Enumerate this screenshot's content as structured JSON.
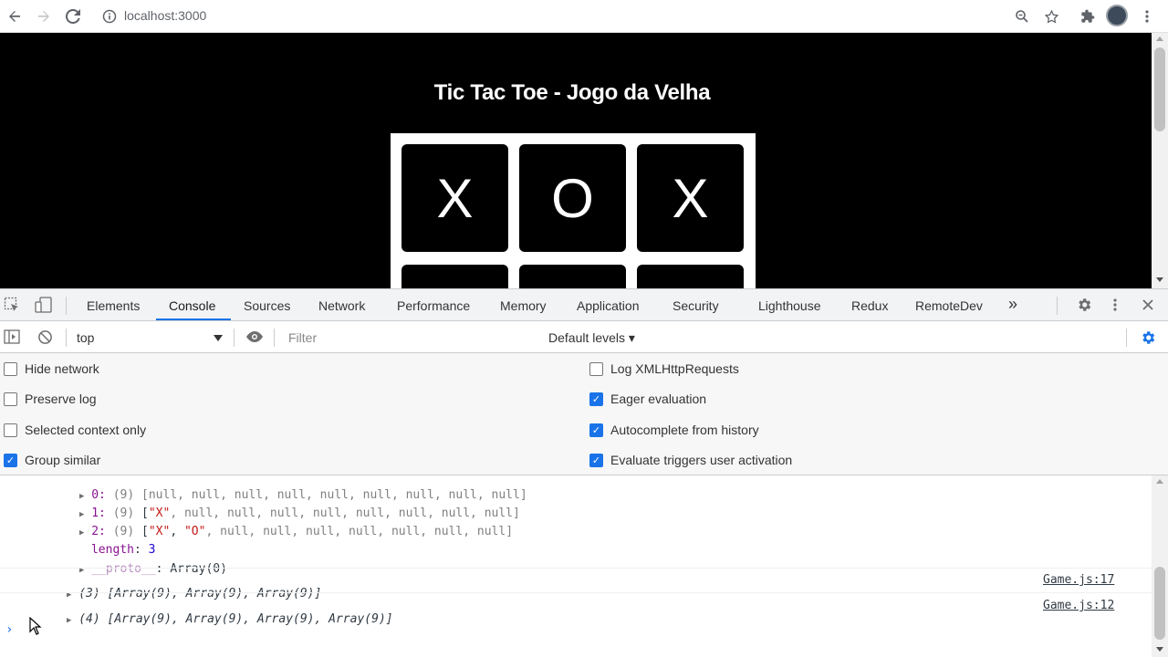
{
  "browser": {
    "url": "localhost:3000"
  },
  "page": {
    "title": "Tic Tac Toe - Jogo da Velha",
    "board_row1": [
      "X",
      "O",
      "X"
    ]
  },
  "devtools": {
    "tabs": [
      "Elements",
      "Console",
      "Sources",
      "Network",
      "Performance",
      "Memory",
      "Application",
      "Security",
      "Lighthouse",
      "Redux",
      "RemoteDev"
    ],
    "active_tab": "Console",
    "more_tabs": "»",
    "context": "top",
    "filter_placeholder": "Filter",
    "levels": "Default levels ▾",
    "settings_left": [
      {
        "label": "Hide network",
        "checked": false
      },
      {
        "label": "Preserve log",
        "checked": false
      },
      {
        "label": "Selected context only",
        "checked": false
      },
      {
        "label": "Group similar",
        "checked": true
      }
    ],
    "settings_right": [
      {
        "label": "Log XMLHttpRequests",
        "checked": false
      },
      {
        "label": "Eager evaluation",
        "checked": true
      },
      {
        "label": "Autocomplete from history",
        "checked": true
      },
      {
        "label": "Evaluate triggers user activation",
        "checked": true
      }
    ],
    "log": {
      "entry0_idx": "0:",
      "entry0_count": "(9)",
      "entry0_value": "[null, null, null, null, null, null, null, null, null]",
      "entry1_idx": "1:",
      "entry1_count": "(9)",
      "entry1_open": "[",
      "entry1_x": "\"X\"",
      "entry1_rest": ", null, null, null, null, null, null, null, null]",
      "entry2_idx": "2:",
      "entry2_count": "(9)",
      "entry2_open": "[",
      "entry2_x": "\"X\"",
      "entry2_sep": ", ",
      "entry2_o": "\"O\"",
      "entry2_rest": ", null, null, null, null, null, null, null]",
      "length_key": "length",
      "length_sep": ": ",
      "length_val": "3",
      "proto_key": "__proto__",
      "proto_val": ": Array(0)",
      "group1": "(3) [Array(9), Array(9), Array(9)]",
      "group1_src": "Game.js:17",
      "group2": "(4) [Array(9), Array(9), Array(9), Array(9)]",
      "group2_src": "Game.js:12",
      "prompt": "›"
    }
  }
}
